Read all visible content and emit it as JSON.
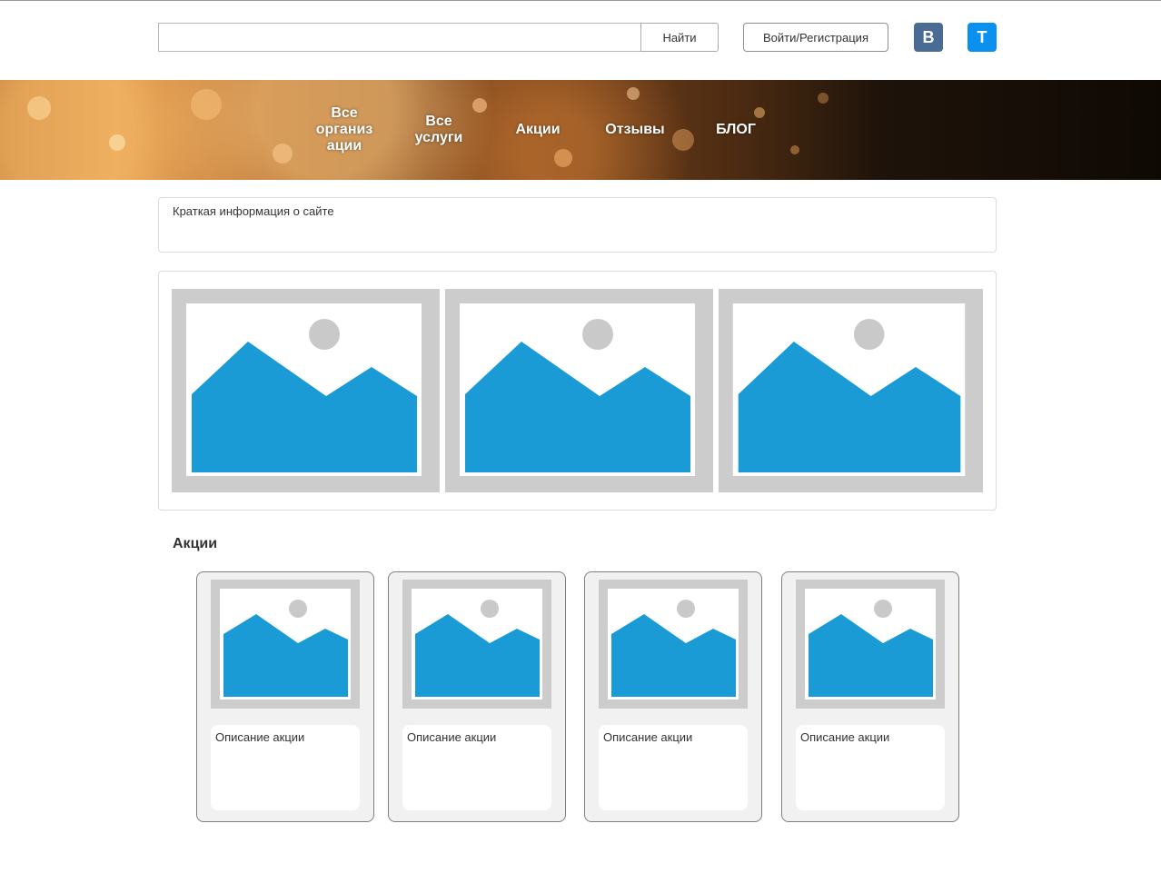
{
  "header": {
    "search": {
      "value": "",
      "placeholder": "",
      "button_label": "Найти"
    },
    "login_label": "Войти/Регистрация",
    "social": {
      "vk_label": "В",
      "telegram_label": "Т"
    }
  },
  "banner": {
    "menu": [
      {
        "label": "Все\nорганиз\nации"
      },
      {
        "label": "Все\nуслуги"
      },
      {
        "label": "Акции"
      },
      {
        "label": "Отзывы"
      },
      {
        "label": "БЛОГ"
      }
    ]
  },
  "info": {
    "text": "Краткая информация о сайте"
  },
  "gallery": {
    "images": [
      "image-placeholder-icon",
      "image-placeholder-icon",
      "image-placeholder-icon"
    ]
  },
  "promotions": {
    "title": "Акции",
    "cards": [
      {
        "description": "Описание акции"
      },
      {
        "description": "Описание акции"
      },
      {
        "description": "Описание акции"
      },
      {
        "description": "Описание акции"
      }
    ]
  },
  "colors": {
    "placeholder_frame": "#cccccc",
    "placeholder_mountain": "#1a9bd6",
    "placeholder_sun": "#c9c9c9",
    "vk_brand": "#4a6c94",
    "telegram_brand": "#0a91f0"
  }
}
